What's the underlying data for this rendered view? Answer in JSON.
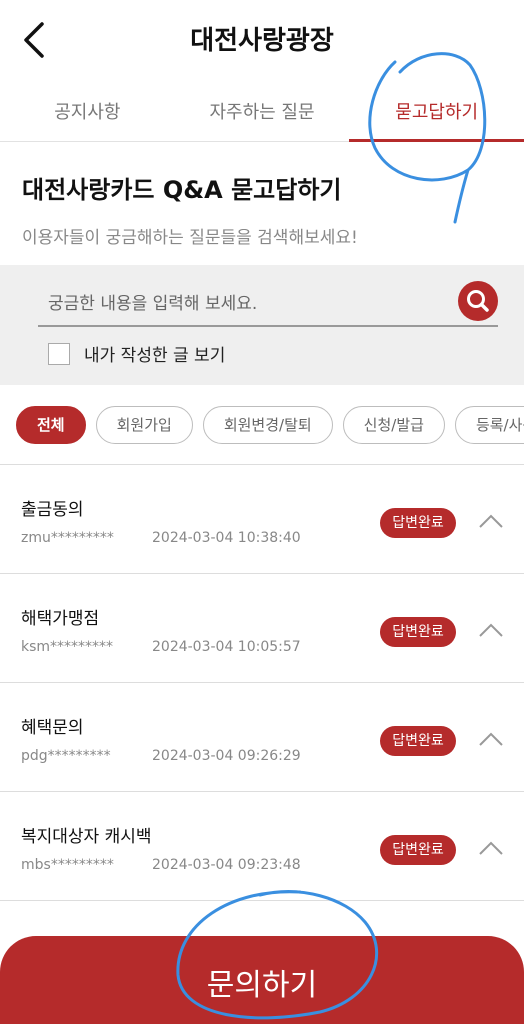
{
  "header": {
    "title": "대전사랑광장",
    "back_icon": "chevron-left-icon"
  },
  "tabs": [
    {
      "label": "공지사항",
      "active": false
    },
    {
      "label": "자주하는 질문",
      "active": false
    },
    {
      "label": "묻고답하기",
      "active": true
    }
  ],
  "intro": {
    "title": "대전사랑카드 Q&A 묻고답하기",
    "subtitle": "이용자들이 궁금해하는 질문들을 검색해보세요!"
  },
  "search": {
    "placeholder": "궁금한 내용을 입력해 보세요.",
    "value": "",
    "button_icon": "search-icon",
    "my_posts_label": "내가 작성한 글 보기",
    "my_posts_checked": false
  },
  "categories": [
    {
      "label": "전체",
      "active": true
    },
    {
      "label": "회원가입",
      "active": false
    },
    {
      "label": "회원변경/탈퇴",
      "active": false
    },
    {
      "label": "신청/발급",
      "active": false
    },
    {
      "label": "등록/사용",
      "active": false
    }
  ],
  "questions": [
    {
      "title": "출금동의",
      "user": "zmu*********",
      "date": "2024-03-04 10:38:40",
      "status": "답변완료"
    },
    {
      "title": "해택가맹점",
      "user": "ksm*********",
      "date": "2024-03-04 10:05:57",
      "status": "답변완료"
    },
    {
      "title": "혜택문의",
      "user": "pdg*********",
      "date": "2024-03-04 09:26:29",
      "status": "답변완료"
    },
    {
      "title": "복지대상자 캐시백",
      "user": "mbs*********",
      "date": "2024-03-04 09:23:48",
      "status": "답변완료"
    }
  ],
  "ask_button": {
    "label": "문의하기"
  },
  "colors": {
    "accent": "#b52b2b",
    "annotation": "#3a8fe0",
    "background": "#ffffff",
    "search_bg": "#efefef"
  }
}
